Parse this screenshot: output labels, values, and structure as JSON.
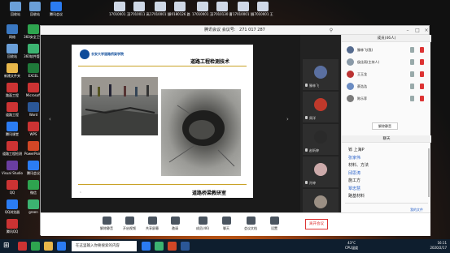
{
  "desktop": {
    "top_icons": [
      {
        "label": "回收站",
        "color": "#6a9fd8"
      },
      {
        "label": "回收站",
        "color": "#6a9fd8"
      },
      {
        "label": "腾讯会议",
        "color": "#2b7cf2"
      },
      {
        "label": "17010001\n王国...",
        "color": "#cfd8e6"
      },
      {
        "label": "17010011\n高远...",
        "color": "#cfd8e6"
      },
      {
        "label": "17010001\n张杰...",
        "color": "#cfd8e6"
      },
      {
        "label": "20180126\n路面...",
        "color": "#cfd8e6"
      },
      {
        "label": "17010001\n王...",
        "color": "#cfd8e6"
      },
      {
        "label": "17010130\n曹...",
        "color": "#cfd8e6"
      },
      {
        "label": "17010001\n张杰...",
        "color": "#cfd8e6"
      },
      {
        "label": "17010001\n王...",
        "color": "#cfd8e6"
      }
    ],
    "left_icons": [
      {
        "label": "网络",
        "color": "#3a78c2"
      },
      {
        "label": "360安全卫士",
        "color": "#2ea44f"
      },
      {
        "label": "回收站",
        "color": "#6a9fd8"
      },
      {
        "label": "360软件管家",
        "color": "#3cb371"
      },
      {
        "label": "新建文件夹",
        "color": "#e8b74a"
      },
      {
        "label": "EXCEL",
        "color": "#1f7a3a"
      },
      {
        "label": "路面工程",
        "color": "#c33"
      },
      {
        "label": "Microsoft",
        "color": "#c33"
      },
      {
        "label": "道路工程",
        "color": "#c33"
      },
      {
        "label": "Word",
        "color": "#2b5797"
      },
      {
        "label": "腾讯课堂",
        "color": "#2b7cf2"
      },
      {
        "label": "WPS",
        "color": "#c33"
      },
      {
        "label": "道路工程检测",
        "color": "#c33"
      },
      {
        "label": "PowerPoint",
        "color": "#d24726"
      },
      {
        "label": "Visual Studio",
        "color": "#6a3ea1"
      },
      {
        "label": "腾讯会议",
        "color": "#2b7cf2"
      },
      {
        "label": "QQ",
        "color": "#c33"
      },
      {
        "label": "微信",
        "color": "#2ea44f"
      },
      {
        "label": "QQ浏览器",
        "color": "#2b7cf2"
      },
      {
        "label": "green",
        "color": "#3cb371"
      },
      {
        "label": "腾讯QQ",
        "color": "#c33"
      }
    ]
  },
  "meeting": {
    "title": "腾讯会议",
    "meeting_id_label": "会议号:",
    "meeting_id": "271 017 287",
    "slide": {
      "school": "长安大学道路桥梁学院",
      "heading": "道路工程检测技术",
      "footer": "道路桥梁教研室",
      "page": "1"
    },
    "video_tiles": [
      {
        "name": "滕林飞",
        "color": "#5a6fa0"
      },
      {
        "name": "周洋",
        "color": "#c0392b"
      },
      {
        "name": "赵昕婷",
        "color": "#2a2a2a"
      },
      {
        "name": "孙婷",
        "color": "#caa"
      },
      {
        "name": "邵冰",
        "color": "#9b8f84"
      }
    ],
    "members_header": "成员(46人)",
    "members": [
      {
        "name": "滕林飞(我)",
        "color": "#556b8f"
      },
      {
        "name": "侯佳雨(主持人)",
        "color": "#8a9aa8"
      },
      {
        "name": "王玉龙",
        "color": "#b33"
      },
      {
        "name": "蔡浩浩",
        "color": "#6b8cc2"
      },
      {
        "name": "陈乐菲",
        "color": "#7b7b7b"
      }
    ],
    "unmute_all": "解除静音",
    "chat_header": "聊天",
    "chat": [
      {
        "text": "铄 上海P",
        "user": false
      },
      {
        "text": "张家伟",
        "user": true
      },
      {
        "text": "材料、方法",
        "user": false
      },
      {
        "text": "邱思涛",
        "user": true
      },
      {
        "text": "施工方",
        "user": false
      },
      {
        "text": "覃忠慧",
        "user": true
      },
      {
        "text": "路基材料",
        "user": false
      }
    ],
    "send_link": "我的文件",
    "toolbar": [
      {
        "label": "解除静音"
      },
      {
        "label": "开启视频"
      },
      {
        "label": "共享屏幕"
      },
      {
        "label": "邀请"
      },
      {
        "label": "成员(46)"
      },
      {
        "label": "聊天"
      },
      {
        "label": "会议文档"
      },
      {
        "label": "设置"
      }
    ],
    "leave": "离开会议"
  },
  "taskbar": {
    "search_placeholder": "在这里输入你要搜索的内容",
    "weather_temp": "43°C",
    "weather_label": "CPU温度",
    "time": "16:11",
    "date": "2020/2/17"
  }
}
